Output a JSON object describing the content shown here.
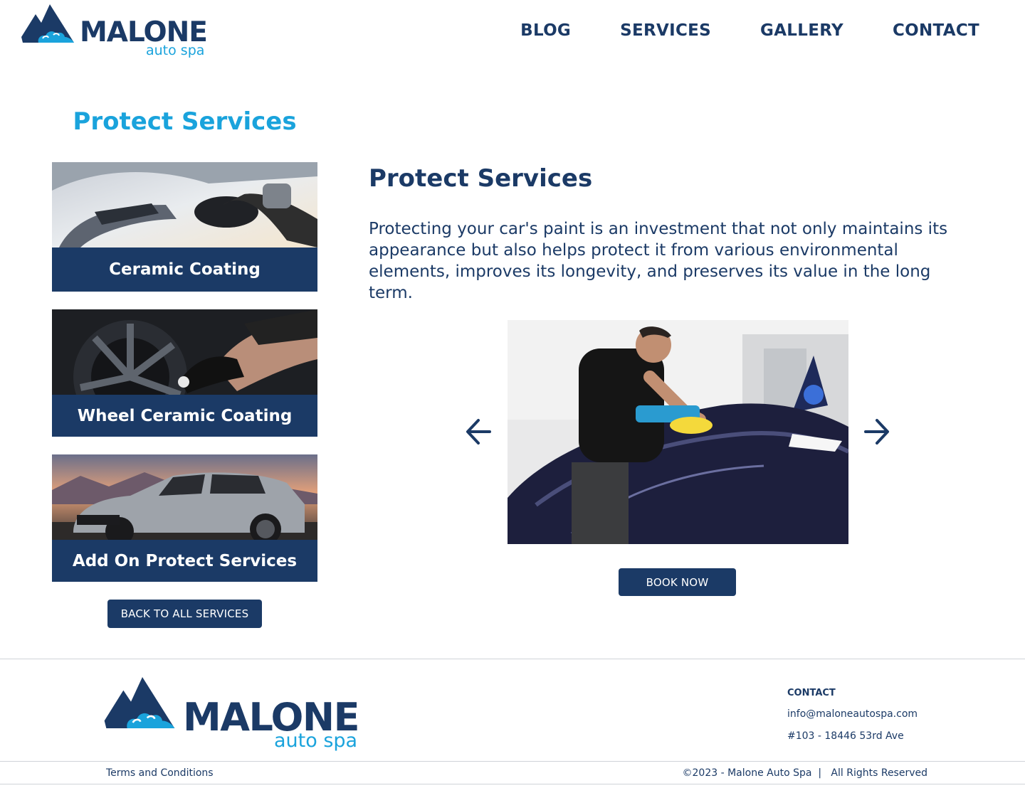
{
  "brand": {
    "name": "MALONE",
    "tagline": "auto spa"
  },
  "nav": {
    "items": [
      "BLOG",
      "SERVICES",
      "GALLERY",
      "CONTACT"
    ]
  },
  "page_title": "Protect Services",
  "cards": [
    {
      "label": "Ceramic Coating"
    },
    {
      "label": "Wheel Ceramic Coating"
    },
    {
      "label": "Add On Protect Services"
    }
  ],
  "back_button": "BACK TO ALL SERVICES",
  "main": {
    "title": "Protect Services",
    "description": "Protecting your car's paint is an investment that not only maintains its appearance but also helps protect it from various environmental elements, improves its longevity, and preserves its value in the long term.",
    "book_button": "BOOK NOW"
  },
  "footer": {
    "brand_name": "MALONE",
    "brand_tagline": "auto spa",
    "contact_heading": "CONTACT",
    "email": "info@maloneautospa.com",
    "address": "#103 - 18446 53rd Ave",
    "terms": "Terms and Conditions",
    "copyright": "©2023 - Malone Auto Spa  |   All Rights Reserved"
  },
  "colors": {
    "navy": "#1b3a66",
    "sky": "#1aa3dc"
  },
  "icons": {
    "prev": "arrow-left-icon",
    "next": "arrow-right-icon",
    "logo": "mountain-cloud-logo"
  }
}
